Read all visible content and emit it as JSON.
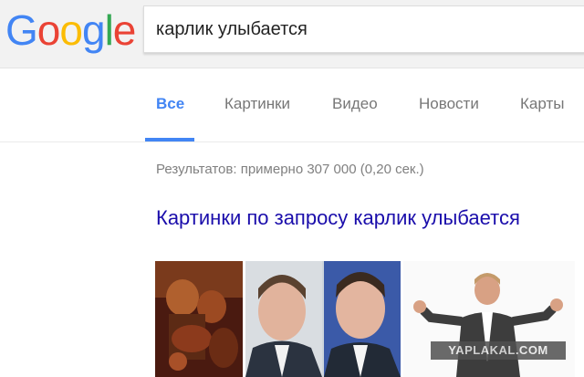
{
  "logo": {
    "letters": [
      "G",
      "o",
      "o",
      "g",
      "l",
      "e"
    ],
    "colors": [
      "#4285f4",
      "#ea4335",
      "#fbbc05",
      "#4285f4",
      "#34a853",
      "#ea4335"
    ]
  },
  "search": {
    "query": "карлик улыбается"
  },
  "tabs": [
    {
      "label": "Все",
      "active": true
    },
    {
      "label": "Картинки",
      "active": false
    },
    {
      "label": "Видео",
      "active": false
    },
    {
      "label": "Новости",
      "active": false
    },
    {
      "label": "Карты",
      "active": false
    }
  ],
  "results": {
    "stats": "Результатов: примерно 307 000 (0,20 сек.)",
    "images_heading": "Картинки по запросу карлик улыбается"
  },
  "images": {
    "watermark": "YAPLAKAL.COM"
  },
  "colors": {
    "accent": "#4285f4",
    "link": "#1a0dab",
    "muted": "#777777"
  }
}
